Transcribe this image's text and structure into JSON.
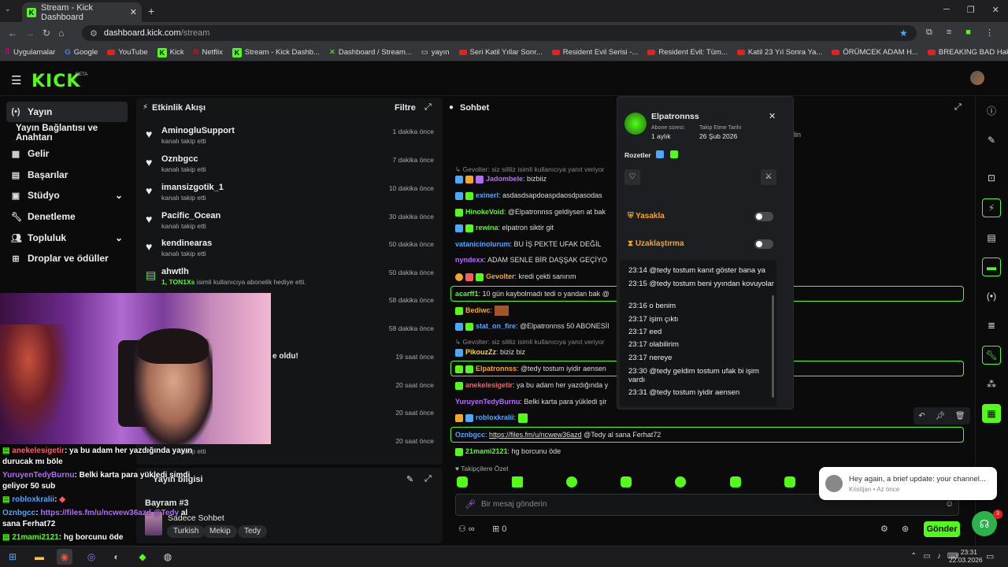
{
  "browser": {
    "tab_title": "Stream - Kick Dashboard",
    "url_host": "dashboard.kick.com",
    "url_path": "/stream",
    "bookmarks": [
      "Uygulamalar",
      "Google",
      "YouTube",
      "Kick",
      "Netflix",
      "Stream - Kick Dashb...",
      "Dashboard / Stream...",
      "yayın",
      "Seri Katil Yıllar Sonr...",
      "Resident Evil Serisi -...",
      "Resident Evil: Tüm...",
      "Katil 23 Yıl Sonra Ya...",
      "ÖRÜMCEK ADAM H...",
      "BREAKING BAD Hak...",
      "MİLYONLAR ÇALAR..."
    ]
  },
  "header": {
    "logo": "KICK",
    "beta": "BETA"
  },
  "sidebar": {
    "items": [
      {
        "label": "Yayın"
      },
      {
        "label": "Yayın Bağlantısı ve Anahtarı"
      },
      {
        "label": "Gelir"
      },
      {
        "label": "Başarılar"
      },
      {
        "label": "Stüdyo"
      },
      {
        "label": "Denetleme"
      },
      {
        "label": "Topluluk"
      },
      {
        "label": "Droplar ve ödüller"
      }
    ]
  },
  "activity": {
    "title": "Etkinlik Akışı",
    "filter": "Filtre",
    "rows": [
      {
        "name": "AminogluSupport",
        "sub": "kanalı takip etti",
        "time": "1 dakika önce"
      },
      {
        "name": "Oznbgcc",
        "sub": "kanalı takip etti",
        "time": "7 dakika önce"
      },
      {
        "name": "imansizgotik_1",
        "sub": "kanalı takip etti",
        "time": "10 dakika önce"
      },
      {
        "name": "Pacific_Ocean",
        "sub": "kanalı takip etti",
        "time": "30 dakika önce"
      },
      {
        "name": "kendinearas",
        "sub": "kanalı takip etti",
        "time": "50 dakika önce"
      },
      {
        "name": "ahwtlh",
        "sub_count": "1,",
        "sub_user": "TON1Xs",
        "sub": "isimli kullanıcıya abonelik hediye etti.",
        "time": "50 dakika önce"
      }
    ],
    "hidden_times": [
      "58 dakika önce",
      "58 dakika önce",
      "19 saat önce",
      "20 saat önce",
      "20 saat önce",
      "20 saat önce"
    ],
    "partial_text": "e oldu!",
    "last_sub": "takip etti"
  },
  "stream_info": {
    "title": "Yayın bilgisi",
    "stream_title": "Bayram #3",
    "category": "Sadece Sohbet",
    "tags": [
      "Turkish",
      "Mekip",
      "Tedy"
    ]
  },
  "overlay_chat": [
    {
      "user": "anekelesigetir",
      "text": ": ya bu adam her yazdığında yayın"
    },
    {
      "user": "",
      "text": "durucak mı böle"
    },
    {
      "user": "YuruyenTedyBurnu",
      "text": ": Belki karta para yükledi şimdi"
    },
    {
      "user": "",
      "text": "geliyor 50 sub"
    },
    {
      "user": "robloxkralii",
      "text": ":"
    },
    {
      "user": "Oznbgcc",
      "text": ":",
      "link": "https://files.fm/u/ncwew36azd",
      "mention": "@Tedy",
      "rest": "al"
    },
    {
      "user": "",
      "text": "sana Ferhat72"
    },
    {
      "user": "21mami2121",
      "text": ": hg borcunu öde"
    }
  ],
  "chat": {
    "title": "Sohbet",
    "partial_right": "lin",
    "messages": [
      {
        "user": "",
        "text": "Gevolter: siz sililiz isimli kullanıcıya yanıt veriyor",
        "reply": true
      },
      {
        "user": "Jadombele",
        "text": ": bizbiiz",
        "color": "#b36bff"
      },
      {
        "user": "exinerl",
        "text": ": asdasdsapdoaspdaosdpasodas",
        "color": "#4aa8ff"
      },
      {
        "user": "HinokeVoid",
        "text": ": @Elpatronnss geldiysen at bak",
        "color": "#53fc18"
      },
      {
        "user": "rewina",
        "text": ": elpatron siktir git",
        "color": "#53fc18"
      },
      {
        "user": "vatanicinolurum",
        "text": ": BU İŞ PEKTE UFAK DEĞİL",
        "color": "#4aa8ff"
      },
      {
        "user": "nyndexx",
        "text": ": ADAM SENLE BİR DAŞŞAK GEÇİYO",
        "color": "#b36bff"
      },
      {
        "user": "Gevolter",
        "text": ": kredi çekti sanırım",
        "color": "#f5a623"
      },
      {
        "user": "acarff1",
        "text": ": 10 gün kaybolmadı tedi o yandan bak @",
        "color": "#53fc18"
      },
      {
        "user": "Bediwc",
        "text": ":",
        "color": "#f5a623"
      },
      {
        "user": "stat_on_fire",
        "text": ": @Elpatronnss 50 ABONESİNİ A",
        "color": "#4aa8ff"
      },
      {
        "user": "",
        "text": "Gevolter: siz sililiz isimli kullanıcıya yanıt veriyor",
        "reply": true
      },
      {
        "user": "PikouzZz",
        "text": ": biziz biz",
        "color": "#f5d623"
      },
      {
        "user": "Elpatronnss",
        "text": ": @tedy tostum iyidir aensen",
        "color": "#f5a623"
      },
      {
        "user": "anekelesigetir",
        "text": ": ya bu adam her yazdığında y",
        "color": "#ff5c5c"
      },
      {
        "user": "YuruyenTedyBurnu",
        "text": ": Belki karta para yükledi şir",
        "color": "#b36bff"
      },
      {
        "user": "robloxkralii",
        "text": ":",
        "color": "#4aa8ff"
      },
      {
        "user": "Oznbgcc",
        "text": ":",
        "link": "https://files.fm/u/ncwew36azd",
        "rest": "@Tedy al sana Ferhat72",
        "color": "#4aa8ff"
      },
      {
        "user": "21mami2121",
        "text": ": hg borcunu öde",
        "color": "#53fc18"
      }
    ],
    "followers_only": "Takipçilere Özel",
    "placeholder": "Bir mesaj gönderin",
    "counter": "0",
    "send": "Gönder"
  },
  "user_popup": {
    "username": "Elpatronnss",
    "sub_label": "Abone süresi:",
    "sub_value": "1 aylık",
    "follow_label": "Takip Etme Tarihi",
    "follow_value": "26 Şub 2026",
    "badges_label": "Rozetler",
    "ban_label": "Yasakla",
    "timeout_label": "Uzaklaştırma",
    "history": [
      "23:14 @tedy tostum kanıt göster bana ya",
      "23:15 @tedy tostum beni yyından kovuyolar",
      "23:16 o benim",
      "23:17 işim çıktı",
      "23:17 eed",
      "23:17 olabilirim",
      "23:17 nereye",
      "23:30 @tedy geldim tostum ufak bi işim vardı",
      "23:31 @tedy tostum iyidir aensen"
    ]
  },
  "toast": {
    "text": "Hey again, a brief update: your channel...",
    "author": "Kristijan",
    "time": "Az önce",
    "badge": "3"
  },
  "taskbar": {
    "time": "23:31",
    "date": "22.03.2026"
  },
  "colors": {
    "accent": "#53fc18",
    "bg": "#0b0b0c",
    "panel": "#141517"
  }
}
